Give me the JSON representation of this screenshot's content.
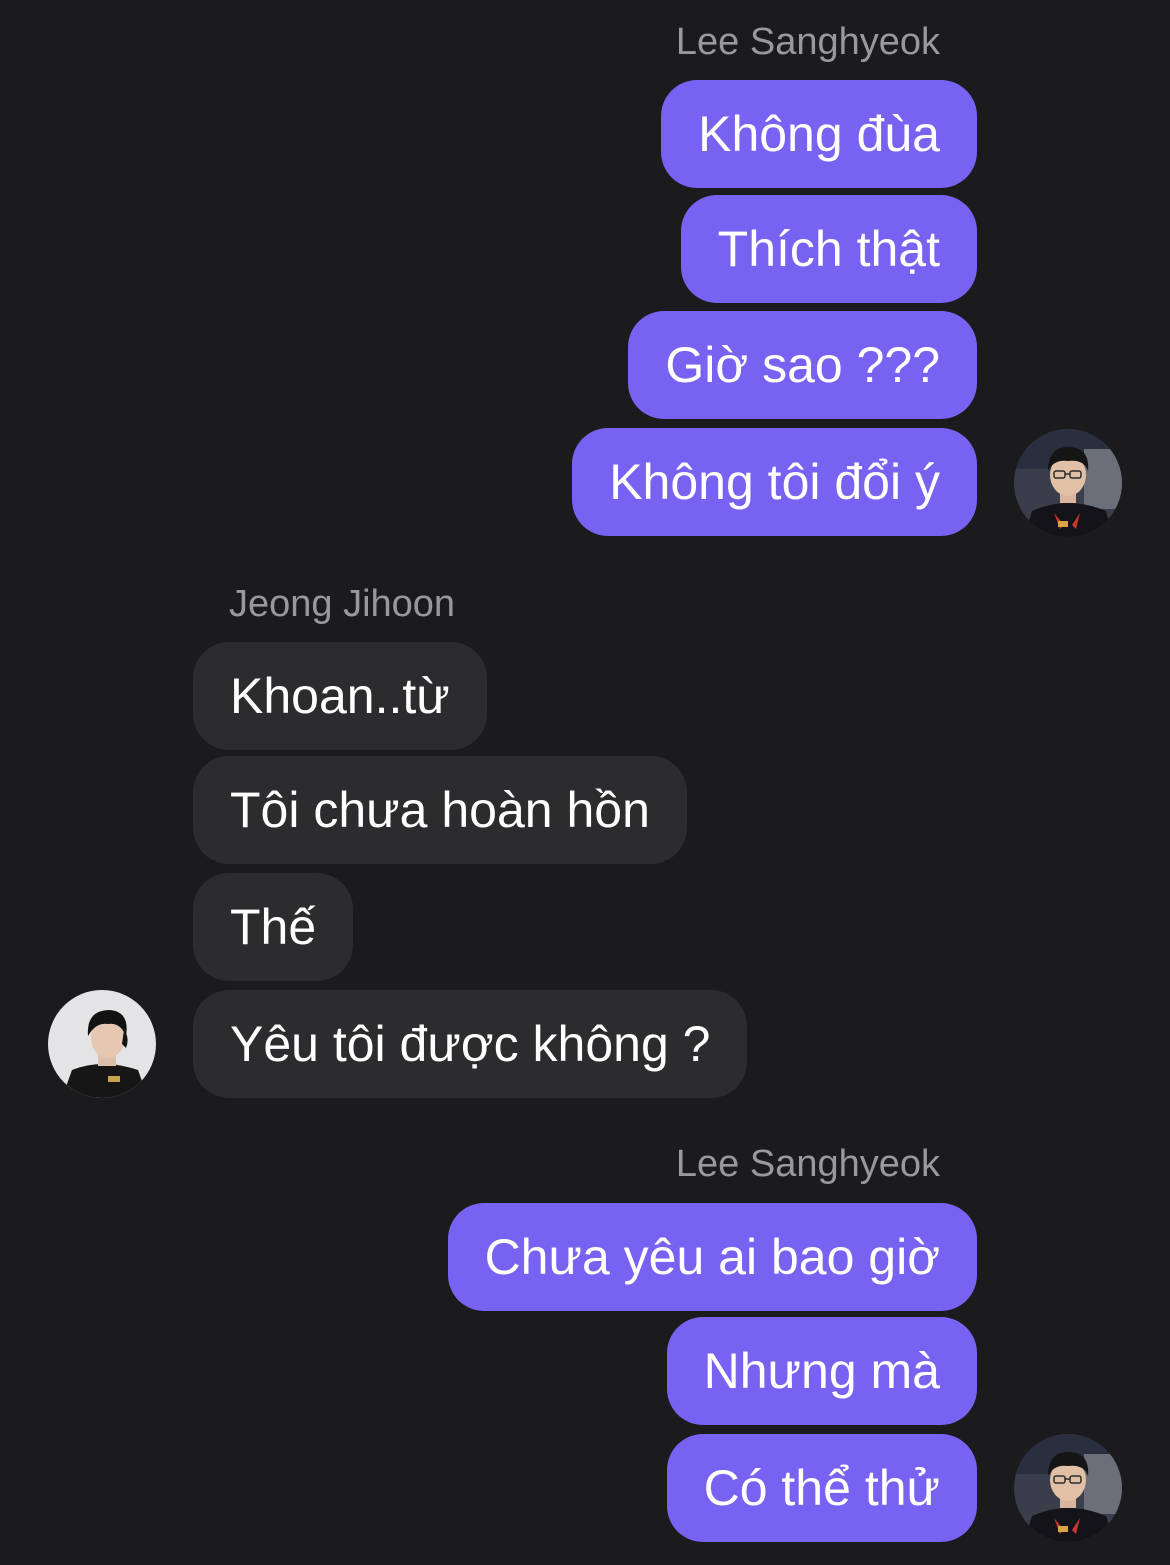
{
  "conversation": {
    "group1": {
      "sender": "Lee Sanghyeok",
      "messages": [
        "Không đùa",
        "Thích thật",
        "Giờ sao ???",
        "Không tôi đổi ý"
      ]
    },
    "group2": {
      "sender": "Jeong Jihoon",
      "messages": [
        "Khoan..từ",
        "Tôi chưa hoàn hồn",
        "Thế",
        "Yêu tôi được không ?"
      ]
    },
    "group3": {
      "sender": "Lee Sanghyeok",
      "messages": [
        "Chưa yêu ai bao giờ",
        "Nhưng mà",
        "Có thể thử"
      ]
    }
  },
  "colors": {
    "background": "#1b1b1d",
    "outgoing_bubble": "#7862f2",
    "incoming_bubble": "#2c2c2e",
    "sender_name": "#98989d",
    "message_text": "#ffffff"
  },
  "icons": {
    "lee_avatar": "profile-photo-lee-sanghyeok",
    "jeong_avatar": "profile-photo-jeong-jihoon"
  }
}
